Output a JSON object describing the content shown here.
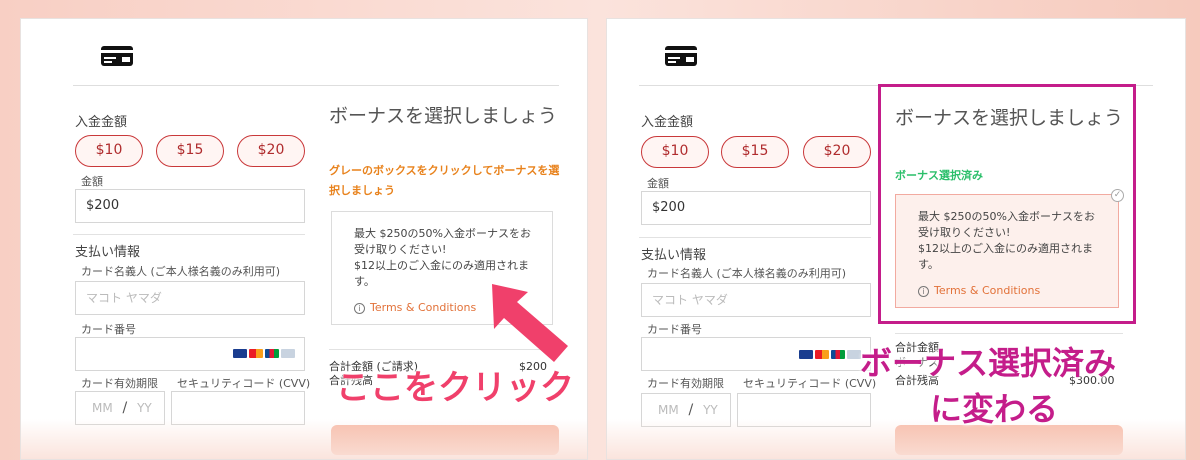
{
  "form": {
    "amount_label": "入金金額",
    "presets": [
      "$10",
      "$15",
      "$20"
    ],
    "amount_sub_label": "金額",
    "amount_value": "$200",
    "payment_label": "支払い情報",
    "cardholder_label": "カード名義人 (ご本人様名義のみ利用可)",
    "cardholder_placeholder": "マコト ヤマダ",
    "card_number_label": "カード番号",
    "expiry_label": "カード有効期限",
    "cvv_label": "セキュリティコード (CVV)",
    "month_placeholder": "MM",
    "year_placeholder": "YY",
    "slash": "/"
  },
  "bonus": {
    "title": "ボーナスを選択しましょう",
    "instruction": "グレーのボックスをクリックしてボーナスを選択しましょう",
    "selected_status": "ボーナス選択済み",
    "line1": "最大 $250の50%入金ボーナスをお受け取りください!",
    "line2": "$12以上のご入金にのみ適用されます。",
    "terms": "Terms & Conditions"
  },
  "totals": {
    "left_label1": "合計金額 (ご請求)",
    "left_label2": "合計残高",
    "left_value1": "$200",
    "right_label1": "合計金額",
    "right_label2": "ボーナス",
    "right_label3": "合計残高",
    "right_value": "$300.00"
  },
  "annotations": {
    "click_here": "ここをクリック",
    "changed_line1": "ボーナス選択済み",
    "changed_line2": "に変わる"
  },
  "colors": {
    "accent_red": "#c9383a",
    "instruction_orange": "#e8821c",
    "selected_green": "#2bbf6a",
    "highlight_magenta": "#c41d8a",
    "arrow_pink": "#f0406b"
  }
}
